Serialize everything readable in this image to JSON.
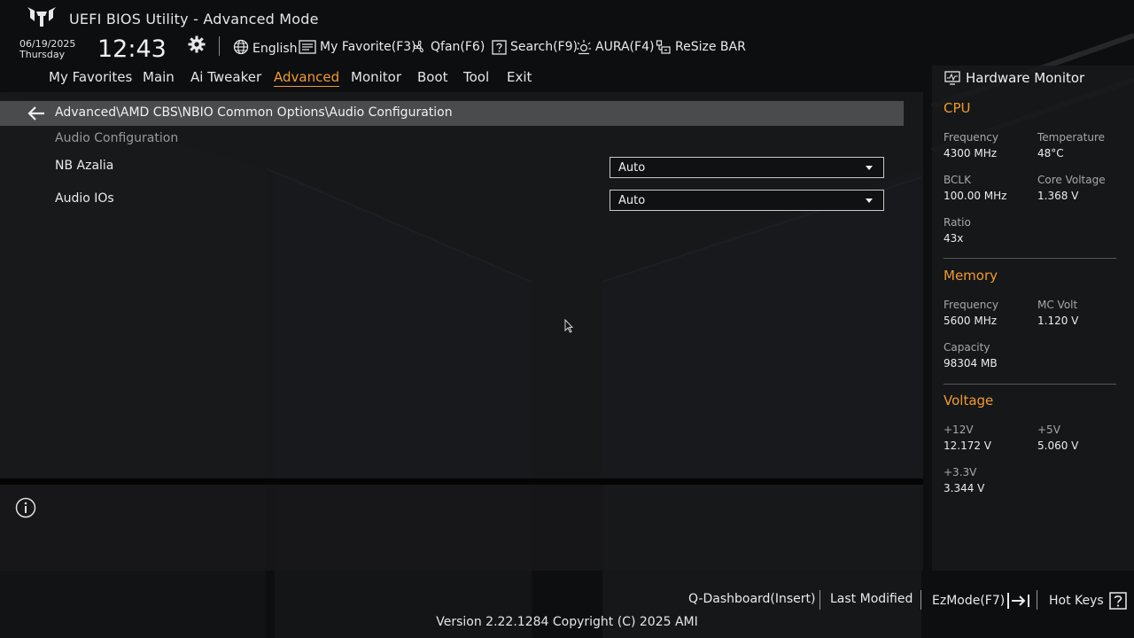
{
  "header": {
    "title": "UEFI BIOS Utility - Advanced Mode",
    "date": "06/19/2025",
    "day": "Thursday",
    "time": "12:43",
    "items": [
      {
        "label": "English",
        "icon": "globe-icon"
      },
      {
        "label": "My Favorite(F3)",
        "icon": "favorite-list-icon"
      },
      {
        "label": "Qfan(F6)",
        "icon": "fan-icon"
      },
      {
        "label": "Search(F9)",
        "icon": "search-help-icon"
      },
      {
        "label": "AURA(F4)",
        "icon": "aura-icon"
      },
      {
        "label": "ReSize BAR",
        "icon": "resize-bar-icon"
      }
    ]
  },
  "nav": {
    "tabs": [
      "My Favorites",
      "Main",
      "Ai Tweaker",
      "Advanced",
      "Monitor",
      "Boot",
      "Tool",
      "Exit"
    ],
    "active": "Advanced"
  },
  "breadcrumb": "Advanced\\AMD CBS\\NBIO Common Options\\Audio Configuration",
  "section_title": "Audio Configuration",
  "settings": [
    {
      "label": "NB Azalia",
      "value": "Auto"
    },
    {
      "label": "Audio IOs",
      "value": "Auto"
    }
  ],
  "hardware_monitor": {
    "title": "Hardware Monitor",
    "cpu": {
      "title": "CPU",
      "frequency_label": "Frequency",
      "frequency": "4300 MHz",
      "temperature_label": "Temperature",
      "temperature": "48°C",
      "bclk_label": "BCLK",
      "bclk": "100.00 MHz",
      "core_voltage_label": "Core Voltage",
      "core_voltage": "1.368 V",
      "ratio_label": "Ratio",
      "ratio": "43x"
    },
    "memory": {
      "title": "Memory",
      "frequency_label": "Frequency",
      "frequency": "5600 MHz",
      "mc_volt_label": "MC Volt",
      "mc_volt": "1.120 V",
      "capacity_label": "Capacity",
      "capacity": "98304 MB"
    },
    "voltage": {
      "title": "Voltage",
      "v12_label": "+12V",
      "v12": "12.172 V",
      "v5_label": "+5V",
      "v5": "5.060 V",
      "v33_label": "+3.3V",
      "v33": "3.344 V"
    }
  },
  "footer": {
    "q_dashboard": "Q-Dashboard(Insert)",
    "last_modified": "Last Modified",
    "ezmode": "EzMode(F7)",
    "hot_keys": "Hot Keys",
    "version": "Version 2.22.1284 Copyright (C) 2025 AMI"
  },
  "colors": {
    "accent": "#f29a2e",
    "background": "#0d0e10",
    "breadcrumb_bar": "#4a4b4d"
  }
}
